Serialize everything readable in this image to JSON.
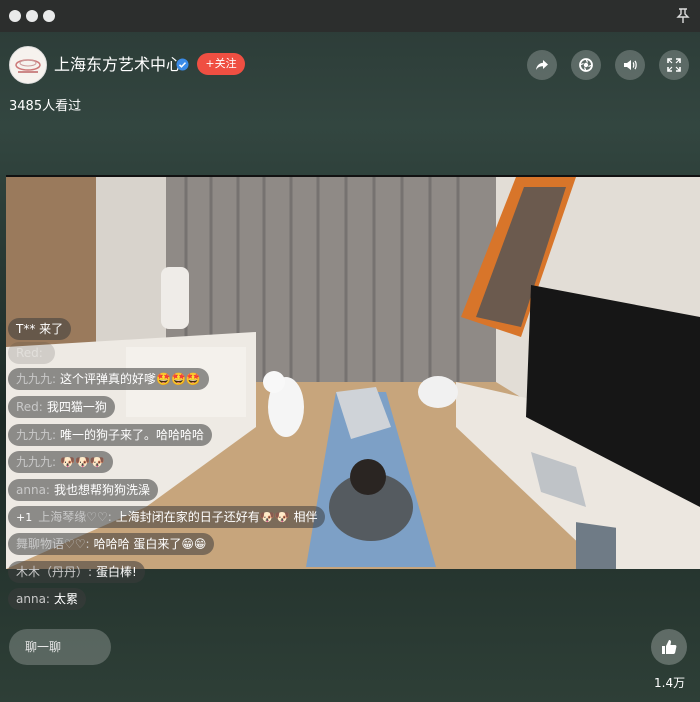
{
  "window": {
    "pin_icon": "pin-icon"
  },
  "header": {
    "channel_name": "上海东方艺术中心",
    "follow_label": "+关注",
    "viewers": "3485人看过"
  },
  "controls": [
    {
      "name": "share-button",
      "icon": "share-icon"
    },
    {
      "name": "shutter-button",
      "icon": "shutter-icon"
    },
    {
      "name": "volume-button",
      "icon": "speaker-icon"
    },
    {
      "name": "fullscreen-button",
      "icon": "fullscreen-icon"
    }
  ],
  "chat": {
    "messages": [
      {
        "user": "",
        "text": "T** 来了"
      },
      {
        "user": "九九九:",
        "text": "这个评弹真的好嗲🤩🤩🤩"
      },
      {
        "user": "Red:",
        "text": "我四猫一狗"
      },
      {
        "user": "九九九:",
        "text": "唯一的狗子来了。哈哈哈哈"
      },
      {
        "user": "九九九:",
        "text": "🐶🐶🐶"
      },
      {
        "user": "anna:",
        "text": "我也想帮狗狗洗澡"
      },
      {
        "level": "+1",
        "user": "上海琴缘♡♡:",
        "text": "上海封闭在家的日子还好有🐶🐶 相伴"
      },
      {
        "user": "舞聊物语♡♡:",
        "text": "哈哈哈 蛋白来了😁😁"
      },
      {
        "user": "木木（丹丹）:",
        "text": "蛋白棒!"
      },
      {
        "user": "anna:",
        "text": "太累"
      }
    ],
    "input_placeholder": "聊一聊"
  },
  "like": {
    "count": "1.4万"
  }
}
